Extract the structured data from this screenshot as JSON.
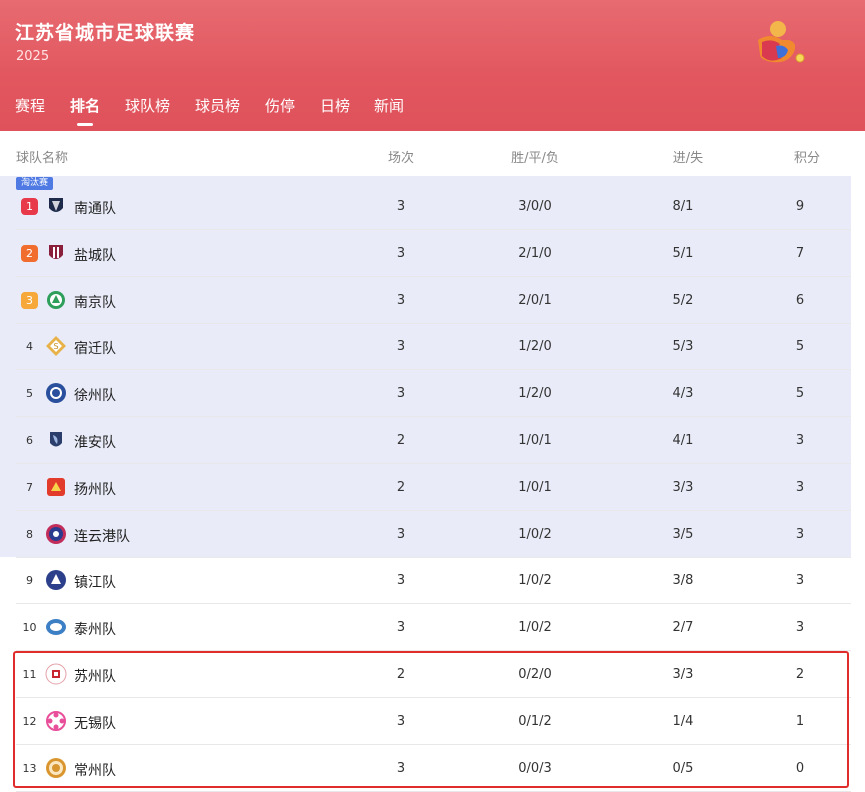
{
  "header": {
    "title": "江苏省城市足球联赛",
    "year": "2025"
  },
  "tabs": [
    {
      "label": "赛程"
    },
    {
      "label": "排名"
    },
    {
      "label": "球队榜"
    },
    {
      "label": "球员榜"
    },
    {
      "label": "伤停"
    },
    {
      "label": "日榜"
    },
    {
      "label": "新闻"
    }
  ],
  "active_tab": "排名",
  "columns": {
    "team": "球队名称",
    "played": "场次",
    "wdl": "胜/平/负",
    "goals": "进/失",
    "points": "积分"
  },
  "zone_badge": "淘汰赛",
  "rows": [
    {
      "rank": "1",
      "team": "南通队",
      "played": "3",
      "wdl": "3/0/0",
      "goals": "8/1",
      "points": "9"
    },
    {
      "rank": "2",
      "team": "盐城队",
      "played": "3",
      "wdl": "2/1/0",
      "goals": "5/1",
      "points": "7"
    },
    {
      "rank": "3",
      "team": "南京队",
      "played": "3",
      "wdl": "2/0/1",
      "goals": "5/2",
      "points": "6"
    },
    {
      "rank": "4",
      "team": "宿迁队",
      "played": "3",
      "wdl": "1/2/0",
      "goals": "5/3",
      "points": "5"
    },
    {
      "rank": "5",
      "team": "徐州队",
      "played": "3",
      "wdl": "1/2/0",
      "goals": "4/3",
      "points": "5"
    },
    {
      "rank": "6",
      "team": "淮安队",
      "played": "2",
      "wdl": "1/0/1",
      "goals": "4/1",
      "points": "3"
    },
    {
      "rank": "7",
      "team": "扬州队",
      "played": "2",
      "wdl": "1/0/1",
      "goals": "3/3",
      "points": "3"
    },
    {
      "rank": "8",
      "team": "连云港队",
      "played": "3",
      "wdl": "1/0/2",
      "goals": "3/5",
      "points": "3"
    },
    {
      "rank": "9",
      "team": "镇江队",
      "played": "3",
      "wdl": "1/0/2",
      "goals": "3/8",
      "points": "3"
    },
    {
      "rank": "10",
      "team": "泰州队",
      "played": "3",
      "wdl": "1/0/2",
      "goals": "2/7",
      "points": "3"
    },
    {
      "rank": "11",
      "team": "苏州队",
      "played": "2",
      "wdl": "0/2/0",
      "goals": "3/3",
      "points": "2"
    },
    {
      "rank": "12",
      "team": "无锡队",
      "played": "3",
      "wdl": "0/1/2",
      "goals": "1/4",
      "points": "1"
    },
    {
      "rank": "13",
      "team": "常州队",
      "played": "3",
      "wdl": "0/0/3",
      "goals": "0/5",
      "points": "0"
    }
  ],
  "colors": {
    "header_bg": "#e2565f",
    "zone_bg": "#e9ecf8",
    "badge_bg": "#4f7ae3",
    "rank1": "#e8394a",
    "rank2": "#f06d2e",
    "rank3": "#f6a83a",
    "highlight_border": "#e12c2c"
  },
  "crest_icons": [
    "nantong-crest-icon",
    "yancheng-crest-icon",
    "nanjing-crest-icon",
    "suqian-crest-icon",
    "xuzhou-crest-icon",
    "huaian-crest-icon",
    "yangzhou-crest-icon",
    "lianyungang-crest-icon",
    "zhenjiang-crest-icon",
    "taizhou-crest-icon",
    "suzhou-crest-icon",
    "wuxi-crest-icon",
    "changzhou-crest-icon"
  ]
}
